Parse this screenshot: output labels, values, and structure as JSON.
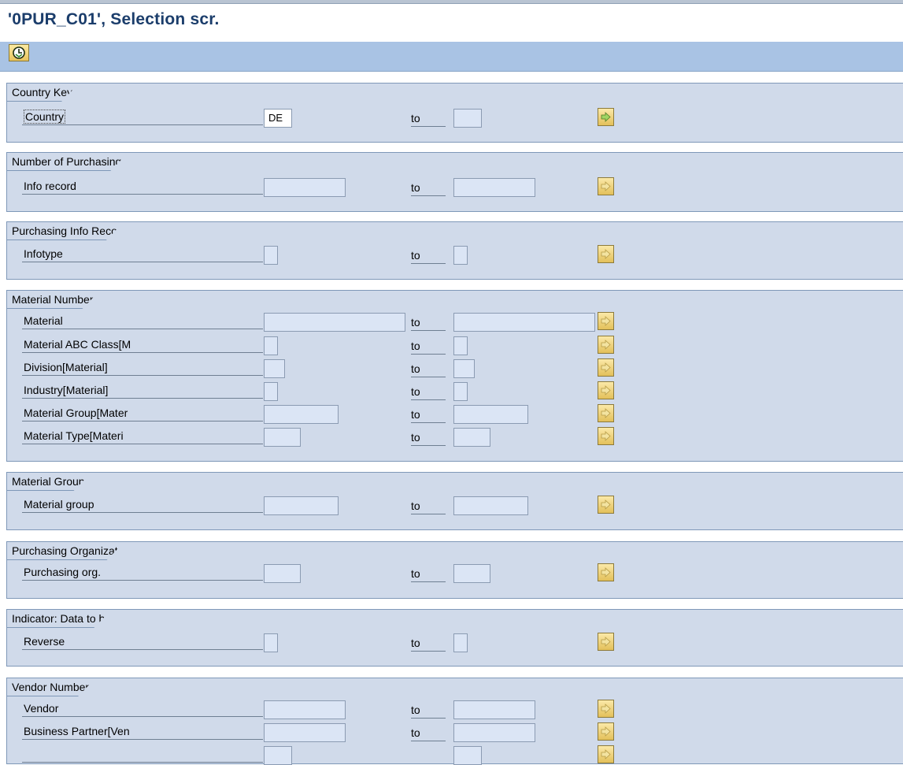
{
  "window": {
    "title": "'0PUR_C01', Selection scr."
  },
  "toolbar": {
    "execute_icon": "execute-clock-icon"
  },
  "common": {
    "to_label": "to"
  },
  "groups": [
    {
      "title": "Country Key",
      "rows": [
        {
          "label": "Country",
          "from": "DE",
          "to": ""
        }
      ]
    },
    {
      "title": "Number of Purchasing",
      "rows": [
        {
          "label": "Info record",
          "from": "",
          "to": ""
        }
      ]
    },
    {
      "title": "Purchasing Info Reco",
      "rows": [
        {
          "label": "Infotype",
          "from": "",
          "to": ""
        }
      ]
    },
    {
      "title": "Material Number",
      "rows": [
        {
          "label": "Material",
          "from": "",
          "to": ""
        },
        {
          "label": "Material ABC Class[M",
          "from": "",
          "to": ""
        },
        {
          "label": "Division[Material]",
          "from": "",
          "to": ""
        },
        {
          "label": "Industry[Material]",
          "from": "",
          "to": ""
        },
        {
          "label": "Material Group[Mater",
          "from": "",
          "to": ""
        },
        {
          "label": "Material Type[Materi",
          "from": "",
          "to": ""
        }
      ]
    },
    {
      "title": "Material Group",
      "rows": [
        {
          "label": "Material group",
          "from": "",
          "to": ""
        }
      ]
    },
    {
      "title": "Purchasing Organizat",
      "rows": [
        {
          "label": "Purchasing org.",
          "from": "",
          "to": ""
        }
      ]
    },
    {
      "title": "Indicator: Data to b",
      "rows": [
        {
          "label": "Reverse",
          "from": "",
          "to": ""
        }
      ]
    },
    {
      "title": "Vendor Number",
      "rows": [
        {
          "label": "Vendor",
          "from": "",
          "to": ""
        },
        {
          "label": "Business Partner[Ven",
          "from": "",
          "to": ""
        },
        {
          "label": "",
          "from": "",
          "to": ""
        }
      ]
    }
  ],
  "colors": {
    "title": "#1b3d6b",
    "toolbar": "#a9c3e4",
    "group_bg": "#d0daea",
    "field_bg": "#dbe5f5",
    "button": "#f0cf6a"
  },
  "icons": {
    "multiple_selection": "arrow-right-icon"
  }
}
